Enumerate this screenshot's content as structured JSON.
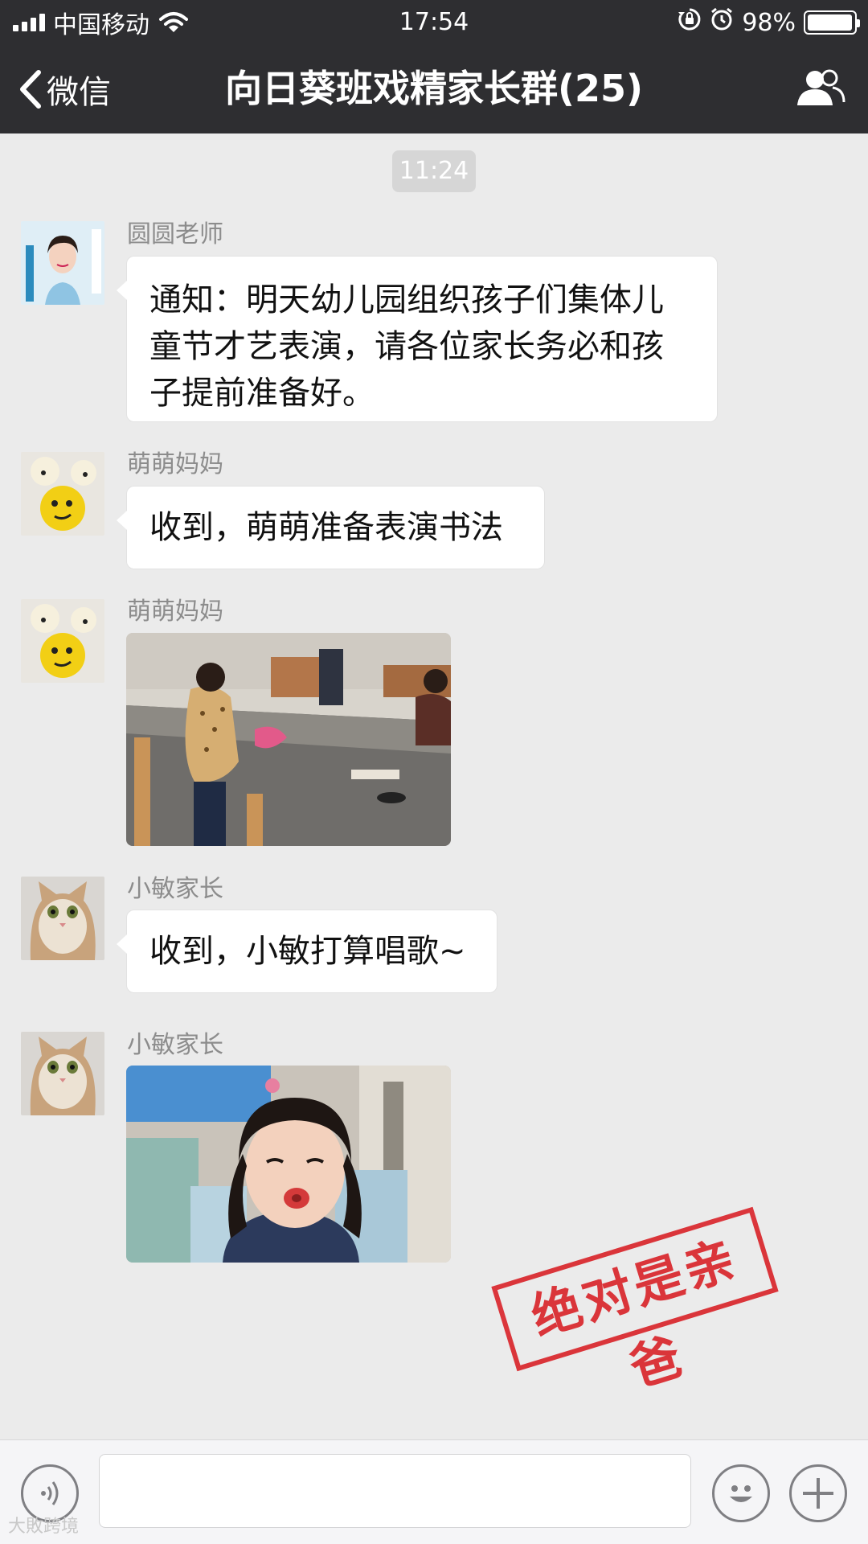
{
  "status_bar": {
    "carrier": "中国移动",
    "time": "17:54",
    "battery": "98%",
    "battery_level": 0.98
  },
  "nav": {
    "back_label": "微信",
    "title": "向日葵班戏精家长群(25)"
  },
  "chat": {
    "time_divider": "11:24",
    "messages": [
      {
        "sender": "圆圆老师",
        "type": "text",
        "text": "通知：明天幼儿园组织孩子们集体儿童节才艺表演，请各位家长务必和孩子提前准备好。"
      },
      {
        "sender": "萌萌妈妈",
        "type": "text",
        "text": "收到，萌萌准备表演书法"
      },
      {
        "sender": "萌萌妈妈",
        "type": "image",
        "image": "children-calligraphy-classroom-photo"
      },
      {
        "sender": "小敏家长",
        "type": "text",
        "text": "收到，小敏打算唱歌~"
      },
      {
        "sender": "小敏家长",
        "type": "image",
        "image": "girl-pouting-photo"
      }
    ]
  },
  "stamp": {
    "text": "绝对是亲爸",
    "color": "#d9262c"
  },
  "input_bar": {
    "voice_icon": "voice-icon",
    "emoji_icon": "emoji-icon",
    "plus_icon": "plus-icon"
  },
  "watermark": "大敗跨境",
  "colors": {
    "bar_bg": "#2e2e31",
    "chat_bg": "#ebebeb",
    "bubble_bg": "#ffffff",
    "sender_text": "#8c8c8c"
  }
}
